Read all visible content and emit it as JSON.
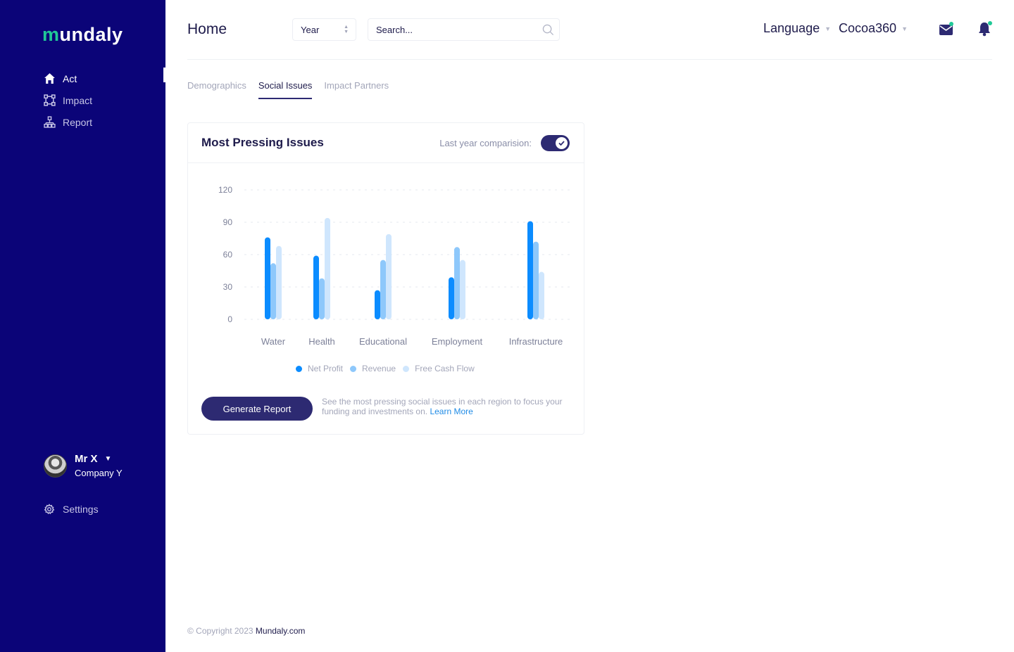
{
  "app": {
    "logo_mark": "m",
    "logo_text": "undaly"
  },
  "sidebar": {
    "items": [
      {
        "label": "Act",
        "icon": "home-icon",
        "active": true
      },
      {
        "label": "Impact",
        "icon": "impact-icon",
        "active": false
      },
      {
        "label": "Report",
        "icon": "report-icon",
        "active": false
      }
    ],
    "user": {
      "name": "Mr X",
      "company": "Company Y"
    },
    "settings_label": "Settings"
  },
  "header": {
    "title": "Home",
    "year_select": "Year",
    "search_placeholder": "Search...",
    "language_label": "Language",
    "org_label": "Cocoa360"
  },
  "tabs": [
    {
      "label": "Demographics",
      "active": false
    },
    {
      "label": "Social Issues",
      "active": true
    },
    {
      "label": "Impact Partners",
      "active": false
    }
  ],
  "card": {
    "title": "Most Pressing Issues",
    "comparison_label": "Last year comparision:",
    "comparison_on": true,
    "button_label": "Generate Report",
    "description": "See the most pressing social issues in each region to focus your funding and investments on.",
    "learn_more": "Learn More"
  },
  "chart_data": {
    "type": "bar",
    "categories": [
      "Water",
      "Health",
      "Educational",
      "Employment",
      "Infrastructure"
    ],
    "series": [
      {
        "name": "Net Profit",
        "color": "#0b8cff",
        "values": [
          76,
          59,
          27,
          39,
          91
        ]
      },
      {
        "name": "Revenue",
        "color": "#8ec8fb",
        "values": [
          52,
          38,
          55,
          67,
          72
        ]
      },
      {
        "name": "Free Cash Flow",
        "color": "#cfe6fd",
        "values": [
          68,
          94,
          79,
          55,
          44
        ]
      }
    ],
    "yticks": [
      0,
      30,
      60,
      90,
      120
    ],
    "ylim": [
      0,
      120
    ],
    "grid": true,
    "legend": "bottom"
  },
  "colors": {
    "sidebar_bg": "#0b0478",
    "accent": "#2d2a72",
    "brand_green": "#20c997",
    "notification_dot": "#20c997"
  },
  "footer": {
    "copyright": "© Copyright 2023",
    "brand": "Mundaly.com"
  }
}
